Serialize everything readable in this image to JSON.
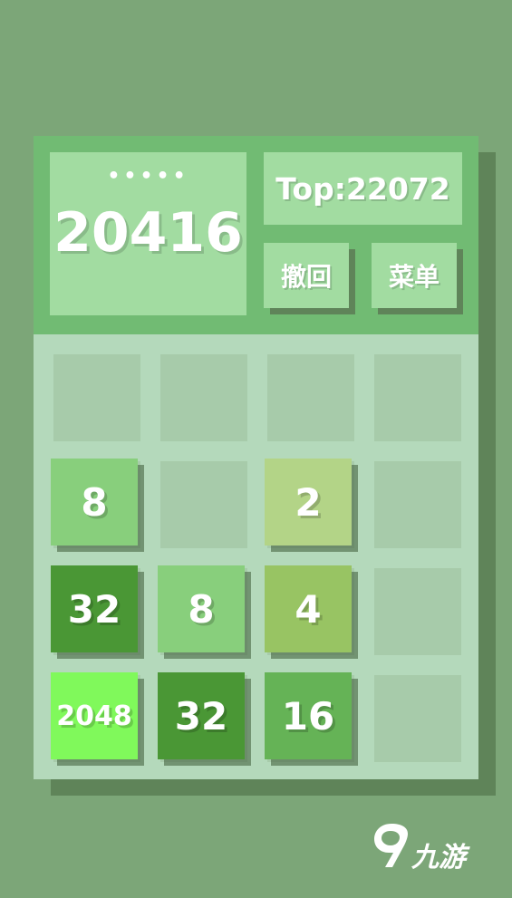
{
  "score": {
    "dots": "•••••",
    "value": "20416"
  },
  "top": {
    "label": "Top:22072"
  },
  "buttons": {
    "undo": "撤回",
    "menu": "菜单"
  },
  "board": {
    "rows": [
      [
        "",
        "",
        "",
        ""
      ],
      [
        "8",
        "",
        "2",
        ""
      ],
      [
        "32",
        "8",
        "4",
        ""
      ],
      [
        "2048",
        "32",
        "16",
        ""
      ]
    ]
  },
  "tile_colors": {
    "2": "#b3d487",
    "4": "#98c463",
    "8": "#88cf7c",
    "16": "#65b356",
    "32": "#4a9735",
    "2048": "#80f95b"
  },
  "colors": {
    "background": "#7ca678",
    "header": "#71bb73",
    "header_box": "#a2dca1",
    "board": "#b4d9bb",
    "empty_cell": "#a7cbaa"
  },
  "watermark": {
    "icon": "9game-logo-icon",
    "text": "九游"
  }
}
